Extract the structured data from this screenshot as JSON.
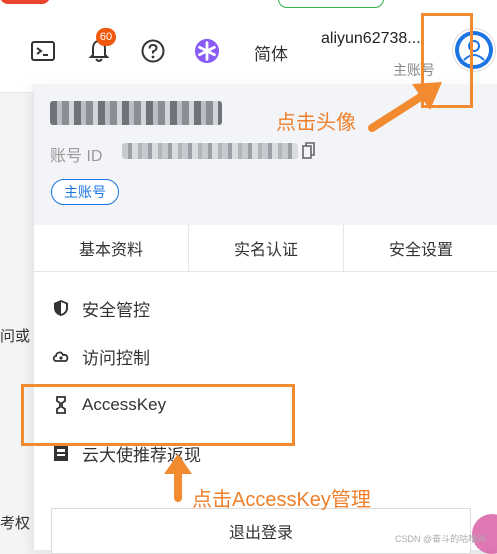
{
  "header": {
    "notification_count": "60",
    "language_label": "简体",
    "username": "aliyun62738...",
    "account_role": "主账号"
  },
  "background_fragments": {
    "frag_1": "问或",
    "frag_2": "考权"
  },
  "dropdown": {
    "account_id_label": "账号 ID",
    "main_account_tag": "主账号",
    "tabs": [
      {
        "label": "基本资料"
      },
      {
        "label": "实名认证"
      },
      {
        "label": "安全设置"
      }
    ],
    "menu": [
      {
        "label": "安全管控",
        "icon": "shield-icon"
      },
      {
        "label": "访问控制",
        "icon": "cloud-key-icon"
      },
      {
        "label": "AccessKey",
        "icon": "access-key-icon"
      },
      {
        "label": "云大使推荐返现",
        "icon": "gift-icon"
      }
    ],
    "logout_label": "退出登录"
  },
  "annotations": {
    "click_avatar": "点击头像",
    "click_accesskey": "点击AccessKey管理",
    "color": "#f28a30"
  },
  "watermark": "CSDN @奋斗的咕噜叫"
}
